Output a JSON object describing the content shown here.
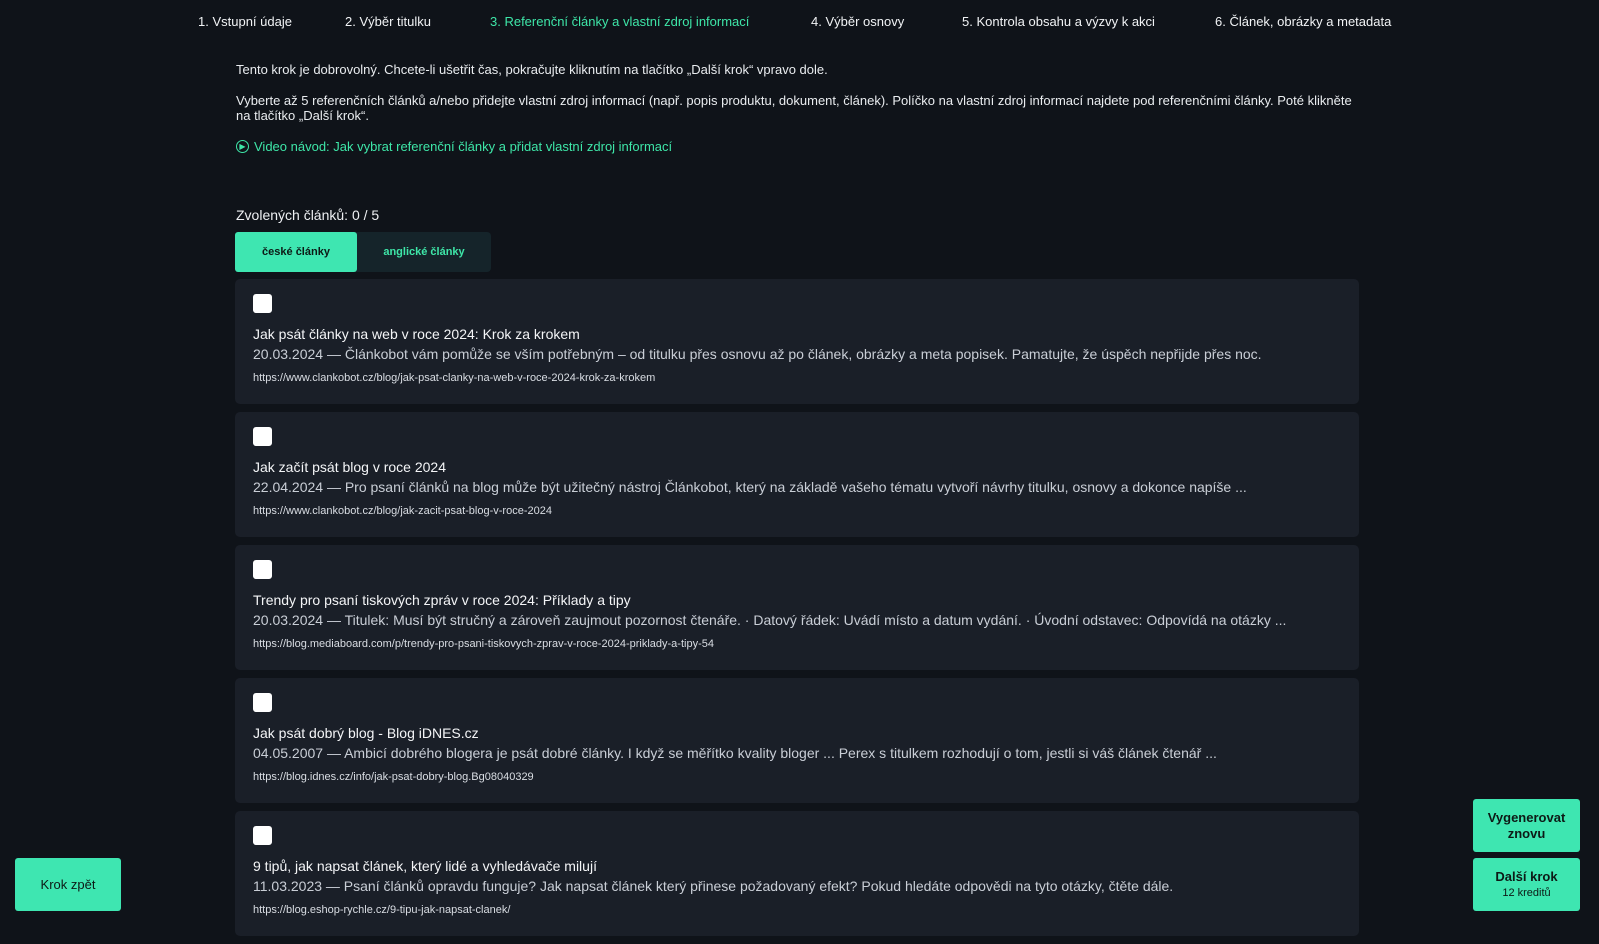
{
  "steps": [
    {
      "label": "1. Vstupní údaje",
      "active": false
    },
    {
      "label": "2. Výběr titulku",
      "active": false
    },
    {
      "label": "3. Referenční články a vlastní zdroj informací",
      "active": true
    },
    {
      "label": "4. Výběr osnovy",
      "active": false
    },
    {
      "label": "5. Kontrola obsahu a výzvy k akci",
      "active": false
    },
    {
      "label": "6. Článek, obrázky a metadata",
      "active": false
    }
  ],
  "intro": {
    "line1": "Tento krok je dobrovolný. Chcete-li ušetřit čas, pokračujte kliknutím na tlačítko „Další krok“ vpravo dole.",
    "line2": "Vyberte až 5 referenčních článků a/nebo přidejte vlastní zdroj informací (např. popis produktu, dokument, článek). Políčko na vlastní zdroj informací najdete pod referenčními články. Poté klikněte na tlačítko „Další krok“.",
    "video_link": "Video návod: Jak vybrat referenční články a přidat vlastní zdroj informací",
    "video_icon": "video-info-icon"
  },
  "selection": {
    "count_label": "Zvolených článků: 0 / 5"
  },
  "tabs": {
    "czech": "české články",
    "english": "anglické články"
  },
  "articles": [
    {
      "title": "Jak psát články na web v roce 2024: Krok za krokem",
      "description": "20.03.2024 — Článkobot vám pomůže se vším potřebným – od titulku přes osnovu až po článek, obrázky a meta popisek. Pamatujte, že úspěch nepřijde přes noc.",
      "url": "https://www.clankobot.cz/blog/jak-psat-clanky-na-web-v-roce-2024-krok-za-krokem"
    },
    {
      "title": "Jak začít psát blog v roce 2024",
      "description": "22.04.2024 — Pro psaní článků na blog může být užitečný nástroj Článkobot, který na základě vašeho tématu vytvoří návrhy titulku, osnovy a dokonce napíše ...",
      "url": "https://www.clankobot.cz/blog/jak-zacit-psat-blog-v-roce-2024"
    },
    {
      "title": "Trendy pro psaní tiskových zpráv v roce 2024: Příklady a tipy",
      "description": "20.03.2024 — Titulek: Musí být stručný a zároveň zaujmout pozornost čtenáře. · Datový řádek: Uvádí místo a datum vydání. · Úvodní odstavec: Odpovídá na otázky ...",
      "url": "https://blog.mediaboard.com/p/trendy-pro-psani-tiskovych-zprav-v-roce-2024-priklady-a-tipy-54"
    },
    {
      "title": "Jak psát dobrý blog - Blog iDNES.cz",
      "description": "04.05.2007 — Ambicí dobrého blogera je psát dobré články. I když se měřítko kvality bloger ... Perex s titulkem rozhodují o tom, jestli si váš článek čtenář ...",
      "url": "https://blog.idnes.cz/info/jak-psat-dobry-blog.Bg08040329"
    },
    {
      "title": "9 tipů, jak napsat článek, který lidé a vyhledávače milují",
      "description": "11.03.2023 — Psaní článků opravdu funguje? Jak napsat článek který přinese požadovaný efekt? Pokud hledáte odpovědi na tyto otázky, čtěte dále.",
      "url": "https://blog.eshop-rychle.cz/9-tipu-jak-napsat-clanek/"
    }
  ],
  "buttons": {
    "back": "Krok zpět",
    "regenerate_line1": "Vygenerovat",
    "regenerate_line2": "znovu",
    "next_line1": "Další krok",
    "next_line2": "12 kreditů"
  },
  "colors": {
    "accent": "#3ee6b1",
    "background": "#0f1319",
    "card": "#1a1f28"
  }
}
